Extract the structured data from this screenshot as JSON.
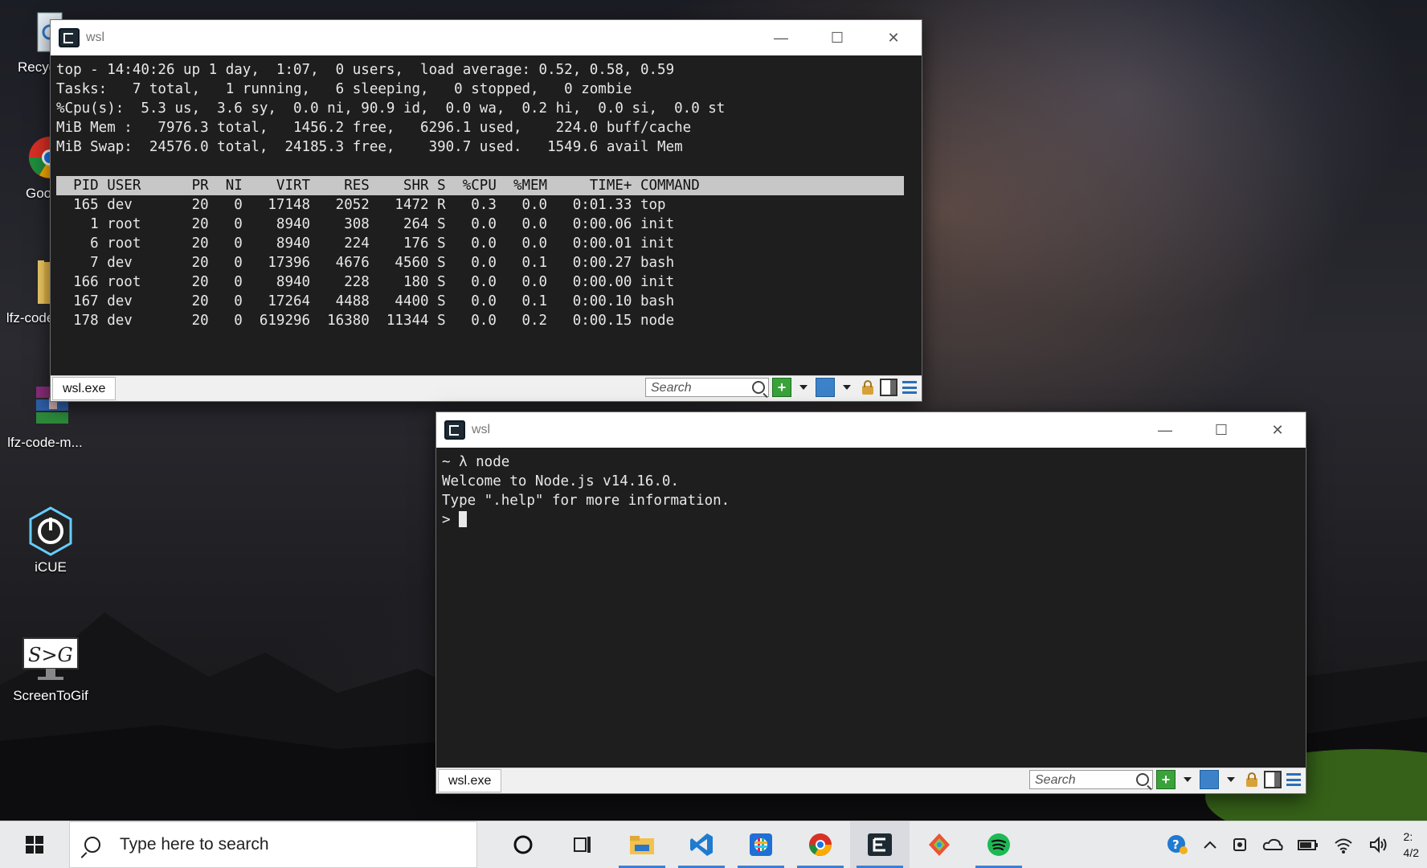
{
  "desktop": {
    "icons": [
      {
        "label": "Recyc"
      },
      {
        "label": "Goo… Chro…"
      },
      {
        "label": "lfz-code-m…"
      },
      {
        "label": "lfz-code-m..."
      },
      {
        "label": "iCUE"
      },
      {
        "label": "ScreenToGif"
      }
    ]
  },
  "window_top": {
    "title": "wsl",
    "lines": [
      "top - 14:40:26 up 1 day,  1:07,  0 users,  load average: 0.52, 0.58, 0.59",
      "Tasks:   7 total,   1 running,   6 sleeping,   0 stopped,   0 zombie",
      "%Cpu(s):  5.3 us,  3.6 sy,  0.0 ni, 90.9 id,  0.0 wa,  0.2 hi,  0.0 si,  0.0 st",
      "MiB Mem :   7976.3 total,   1456.2 free,   6296.1 used,    224.0 buff/cache",
      "MiB Swap:  24576.0 total,  24185.3 free,    390.7 used.   1549.6 avail Mem",
      ""
    ],
    "table_header": "  PID USER      PR  NI    VIRT    RES    SHR S  %CPU  %MEM     TIME+ COMMAND",
    "rows": [
      "  165 dev       20   0   17148   2052   1472 R   0.3   0.0   0:01.33 top",
      "    1 root      20   0    8940    308    264 S   0.0   0.0   0:00.06 init",
      "    6 root      20   0    8940    224    176 S   0.0   0.0   0:00.01 init",
      "    7 dev       20   0   17396   4676   4560 S   0.0   0.1   0:00.27 bash",
      "  166 root      20   0    8940    228    180 S   0.0   0.0   0:00.00 init",
      "  167 dev       20   0   17264   4488   4400 S   0.0   0.1   0:00.10 bash",
      "  178 dev       20   0  619296  16380  11344 S   0.0   0.2   0:00.15 node"
    ],
    "status_tab": "wsl.exe",
    "search_placeholder": "Search"
  },
  "window_bottom": {
    "title": "wsl",
    "prompt_line": "~ λ node",
    "lines": [
      "Welcome to Node.js v14.16.0.",
      "Type \".help\" for more information."
    ],
    "repl_prompt": "> ",
    "status_tab": "wsl.exe",
    "search_placeholder": "Search"
  },
  "taskbar": {
    "search_text": "Type here to search",
    "clock_time": "2:",
    "clock_date": "4/2"
  },
  "colors": {
    "terminal_bg": "#1e1e1e",
    "header_bar": "#c7c7c7",
    "prompt_green": "#6fbf5f",
    "taskbar_accent": "#3b7fd4"
  }
}
